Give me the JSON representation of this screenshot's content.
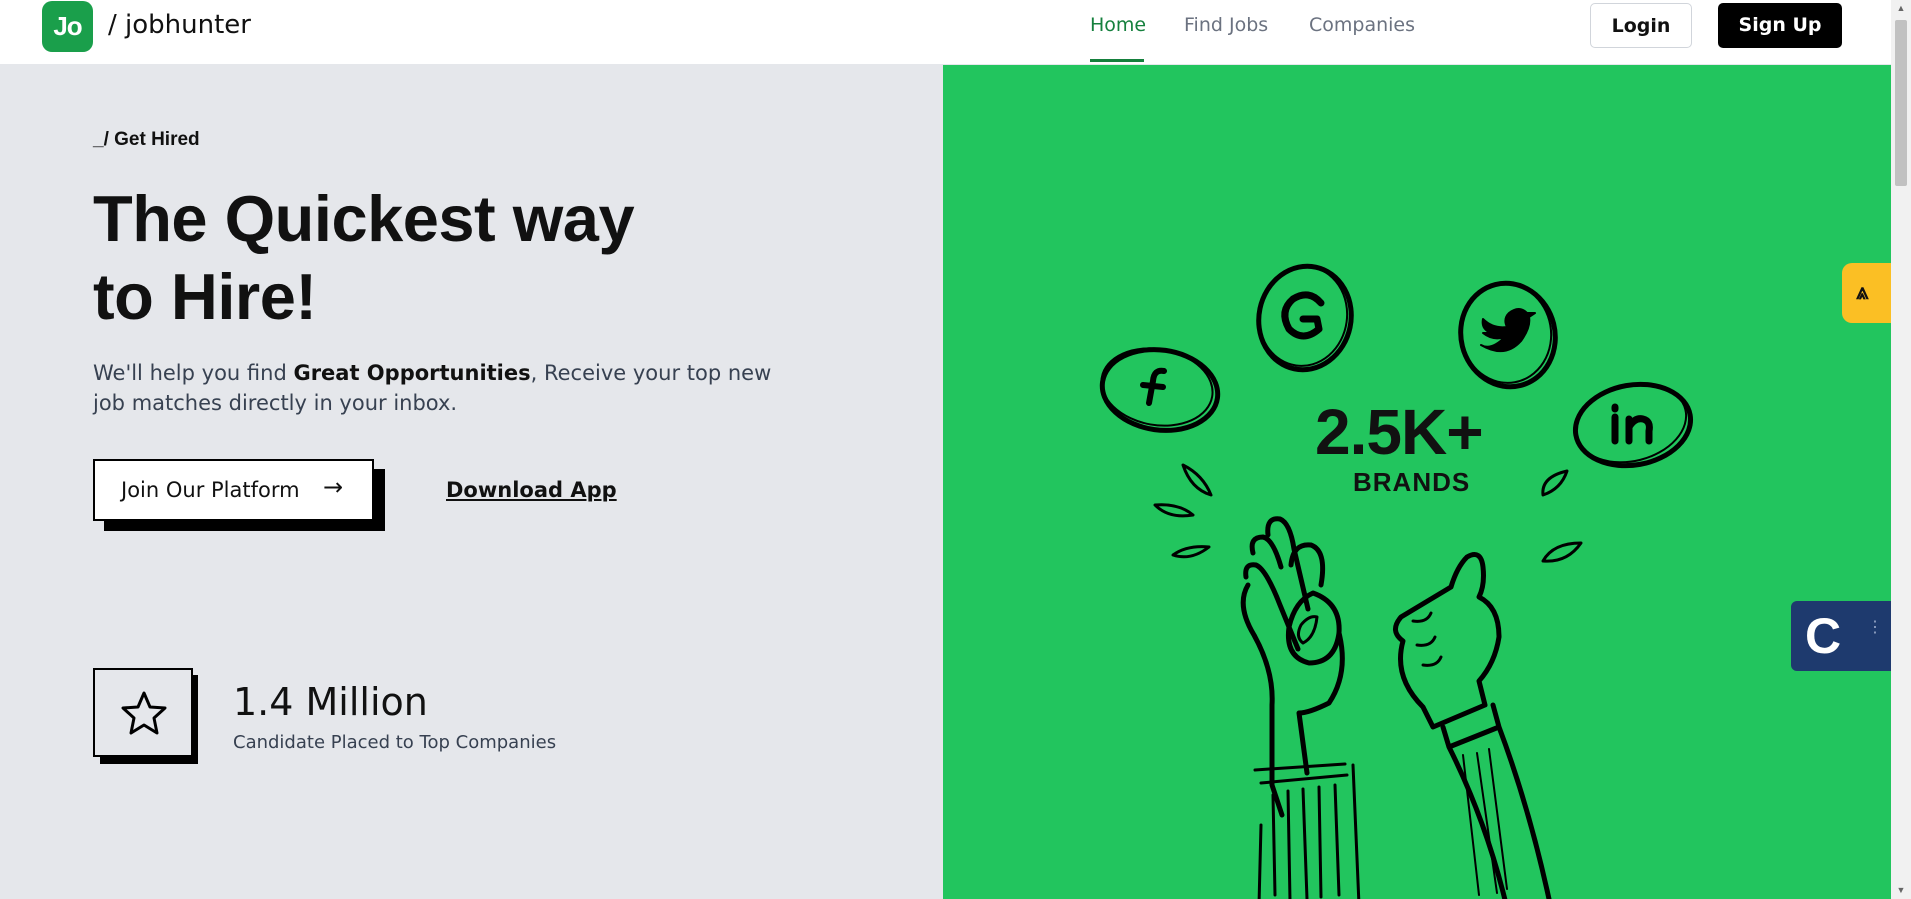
{
  "header": {
    "logo_text": "Jo",
    "brand": "/ jobhunter",
    "nav": [
      "Home",
      "Find Jobs",
      "Companies"
    ],
    "active_nav": "Home",
    "login_label": "Login",
    "signup_label": "Sign Up"
  },
  "hero": {
    "eyebrow": "_/ Get Hired",
    "headline_line1": "The Quickest way",
    "headline_line2": "to Hire!",
    "desc_prefix": "We'll help you find ",
    "desc_bold": "Great Opportunities",
    "desc_suffix": ", Receive your top new job matches directly in your inbox.",
    "join_label": "Join Our Platform",
    "join_arrow": "→",
    "download_label": "Download App"
  },
  "stat": {
    "value": "1.4 Million",
    "label": "Candidate Placed to Top Companies",
    "icon": "star-icon"
  },
  "illustration": {
    "count": "2.5K+",
    "label": "BRANDS",
    "icons": [
      "facebook-icon",
      "google-icon",
      "twitter-icon",
      "linkedin-icon"
    ],
    "background_color": "#22c55e"
  },
  "widgets": {
    "yellow_icon": "⩓",
    "blue_letter": "C",
    "blue_dots": "⋮⋮"
  },
  "colors": {
    "accent": "#15803d",
    "logo_bg": "#1a9f4b",
    "left_bg": "#e5e7eb",
    "right_bg": "#22c55e"
  }
}
